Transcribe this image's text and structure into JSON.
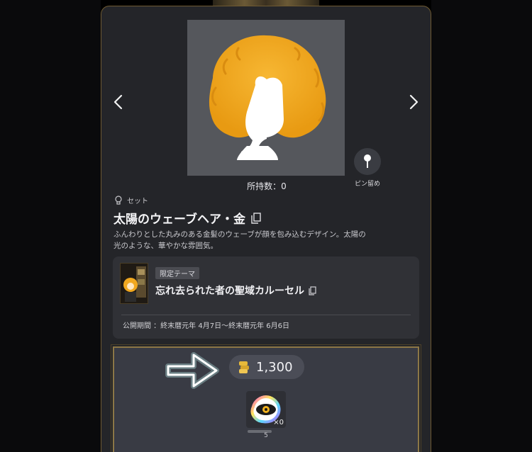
{
  "item": {
    "owned_label": "所持数：0",
    "pin_label": "ピン留め",
    "set_label": "セット",
    "title": "太陽のウェーブヘア・金",
    "description_line1": "ふんわりとした丸みのある金髪のウェーブが顔を包み込むデザイン。太陽の",
    "description_line2": "光のような、華やかな雰囲気。"
  },
  "theme": {
    "badge": "限定テーマ",
    "name": "忘れ去られた者の聖域カルーセル",
    "period": "公開期間 ：終末暦元年 4月7日～終末暦元年 6月6日"
  },
  "price": {
    "value": "1,300"
  },
  "reward": {
    "count": "×0",
    "number": "5"
  },
  "icons": {
    "prev": "chevron-left-icon",
    "next": "chevron-right-icon",
    "pin": "pin-icon",
    "bulb": "lightbulb-icon",
    "copy": "copy-icon",
    "coin": "gold-coin-icon",
    "arrow": "glowing-arrow-icon"
  },
  "colors": {
    "panel": "#242529",
    "border_gold": "#8d7746",
    "hair": "#f1a81f",
    "coin": "#e7b93a"
  }
}
